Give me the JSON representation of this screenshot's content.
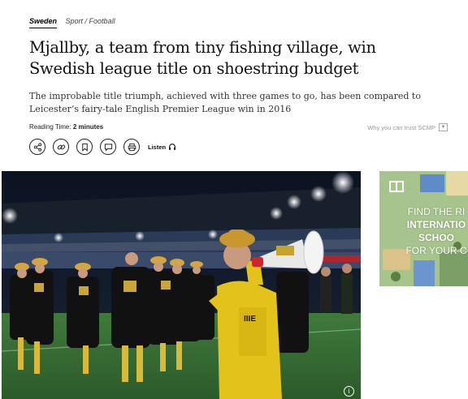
{
  "section": {
    "name": "Sweden",
    "sub": "Sport / Football"
  },
  "headline": "Mjallby, a team from tiny fishing village, win Swedish league title on shoestring budget",
  "deck": "The improbable title triumph, achieved with three games to go, has been compared to Leicester’s fairy-tale English Premier League win in 2016",
  "meta": {
    "reading_label": "Reading Time:",
    "reading_value": "2 minutes",
    "trust_text": "Why you can trust SCMP"
  },
  "actions": {
    "listen_label": "Listen"
  },
  "ad": {
    "line1": "FIND THE RI",
    "line2": "INTERNATIO",
    "line3": "SCHOO",
    "line4": "FOR YOUR C"
  },
  "photo": {
    "info_glyph": "i",
    "banner_text": "IIIE"
  }
}
